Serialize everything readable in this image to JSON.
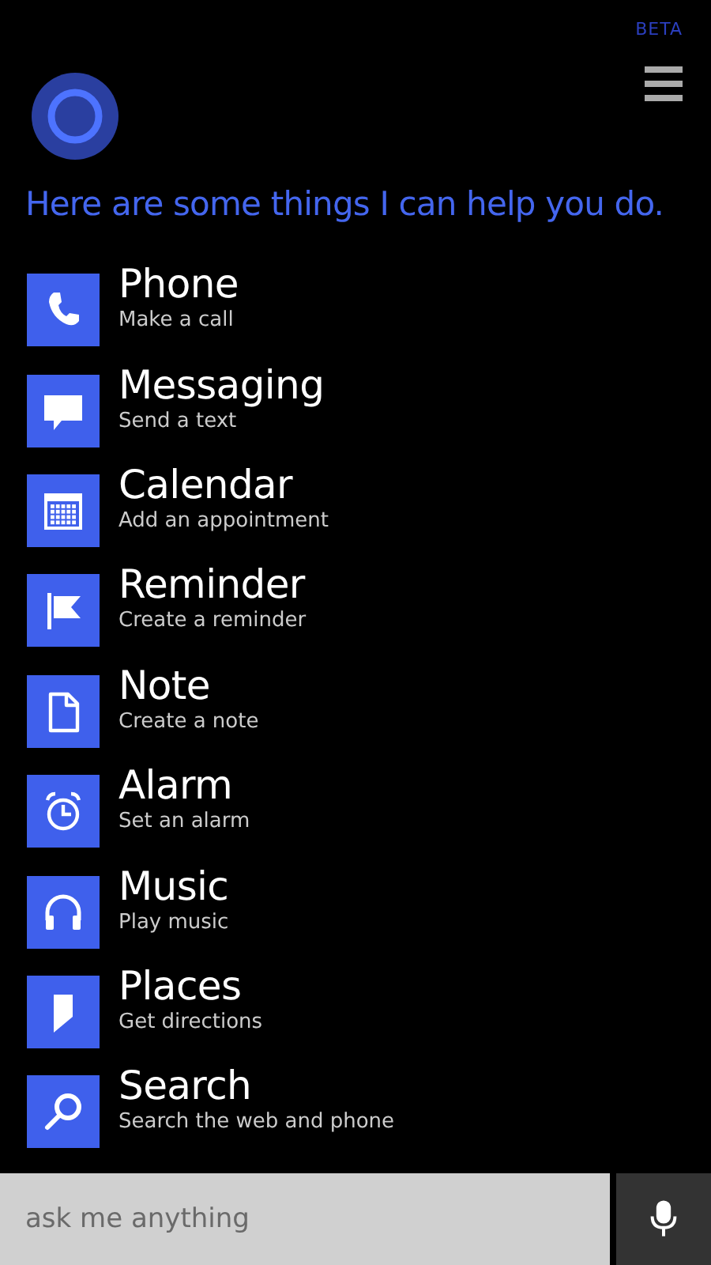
{
  "header": {
    "badge": "BETA"
  },
  "prompt": "Here are some things I can help you do.",
  "items": [
    {
      "kind": "phone",
      "title": "Phone",
      "subtitle": "Make a call"
    },
    {
      "kind": "messaging",
      "title": "Messaging",
      "subtitle": "Send a text"
    },
    {
      "kind": "calendar",
      "title": "Calendar",
      "subtitle": "Add an appointment"
    },
    {
      "kind": "reminder",
      "title": "Reminder",
      "subtitle": "Create a reminder"
    },
    {
      "kind": "note",
      "title": "Note",
      "subtitle": "Create a note"
    },
    {
      "kind": "alarm",
      "title": "Alarm",
      "subtitle": "Set an alarm"
    },
    {
      "kind": "music",
      "title": "Music",
      "subtitle": "Play music"
    },
    {
      "kind": "places",
      "title": "Places",
      "subtitle": "Get directions"
    },
    {
      "kind": "search",
      "title": "Search",
      "subtitle": "Search the web and phone"
    }
  ],
  "search": {
    "placeholder": "ask me anything"
  }
}
